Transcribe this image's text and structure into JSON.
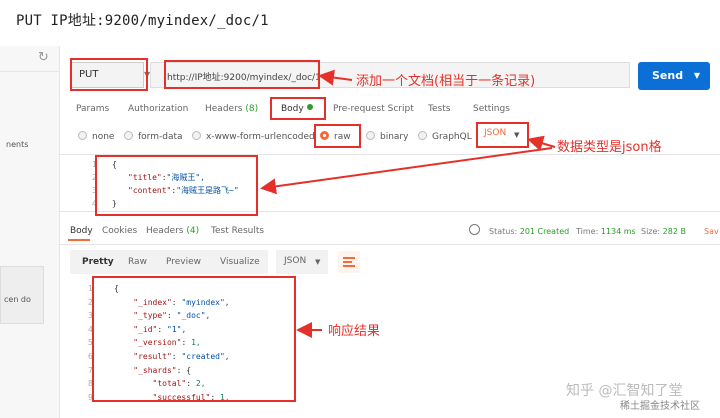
{
  "caption": "PUT IP地址:9200/myindex/_doc/1",
  "sidebar": {
    "text1": "nents",
    "text2": "cen do"
  },
  "request": {
    "method": "PUT",
    "url": "http://IP地址:9200/myindex/_doc/1",
    "send_label": "Send"
  },
  "request_tabs": [
    {
      "label": "Params"
    },
    {
      "label": "Authorization"
    },
    {
      "label": "Headers",
      "count": "(8)"
    },
    {
      "label": "Body"
    },
    {
      "label": "Pre-request Script"
    },
    {
      "label": "Tests"
    },
    {
      "label": "Settings"
    }
  ],
  "body_types": [
    "none",
    "form-data",
    "x-www-form-urlencoded",
    "raw",
    "binary",
    "GraphQL"
  ],
  "body_format": "JSON",
  "request_body": {
    "open": "{",
    "line1_key": "\"title\"",
    "line1_val": "\"海贼王\",",
    "line2_key": "\"content\"",
    "line2_val": "\"海贼王是路飞~\"",
    "close": "}"
  },
  "response_tabs": [
    {
      "label": "Body"
    },
    {
      "label": "Cookies"
    },
    {
      "label": "Headers",
      "count": "(4)"
    },
    {
      "label": "Test Results"
    }
  ],
  "response_status": {
    "status_label": "Status:",
    "status_value": "201 Created",
    "time_label": "Time:",
    "time_value": "1134 ms",
    "size_label": "Size:",
    "size_value": "282 B",
    "save_label": "Sav"
  },
  "response_view": {
    "modes": [
      "Pretty",
      "Raw",
      "Preview",
      "Visualize"
    ],
    "format": "JSON"
  },
  "response_body": [
    {
      "text": "{"
    },
    {
      "indent": 1,
      "key": "\"_index\"",
      "val": "\"myindex\",",
      "type": "s"
    },
    {
      "indent": 1,
      "key": "\"_type\"",
      "val": "\"_doc\",",
      "type": "s"
    },
    {
      "indent": 1,
      "key": "\"_id\"",
      "val": "\"1\",",
      "type": "s"
    },
    {
      "indent": 1,
      "key": "\"_version\"",
      "val": "1,",
      "type": "n"
    },
    {
      "indent": 1,
      "key": "\"result\"",
      "val": "\"created\",",
      "type": "s"
    },
    {
      "indent": 1,
      "key": "\"_shards\"",
      "val": "{",
      "type": "p"
    },
    {
      "indent": 2,
      "key": "\"total\"",
      "val": "2,",
      "type": "n"
    },
    {
      "indent": 2,
      "key": "\"successful\"",
      "val": "1,",
      "type": "n"
    }
  ],
  "annotations": {
    "add_doc": "添加一个文档(相当于一条记录)",
    "data_type": "数据类型是json格",
    "response": "响应结果"
  },
  "watermark": {
    "line1": "知乎 @汇智知了堂",
    "line2": "稀土掘金技术社区"
  },
  "colors": {
    "accent": "#f26b3a",
    "send": "#0b6fd6",
    "annotation": "#e5302a",
    "success": "#2a9d2a"
  }
}
